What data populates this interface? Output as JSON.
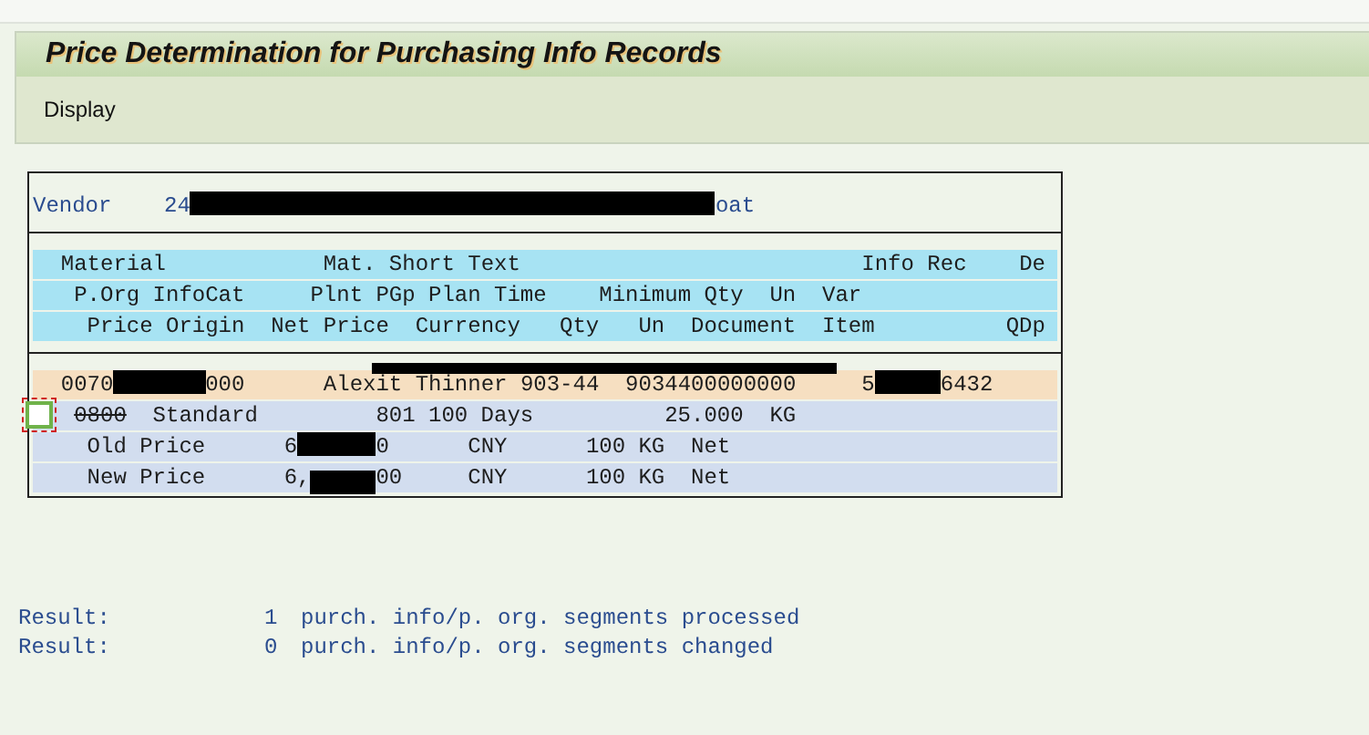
{
  "title": "Price Determination for Purchasing Info Records",
  "toolbar": [
    {
      "label": "Display"
    }
  ],
  "vendor": {
    "label": "Vendor",
    "value_start": "24",
    "value_end": "oat"
  },
  "header_rows": [
    [
      "Material",
      "Mat. Short Text",
      "Info Rec",
      "De"
    ],
    [
      "P.Org",
      "InfoCat",
      "Plnt",
      "PGp",
      "Plan Time",
      "Minimum Qty",
      "Un",
      "Var"
    ],
    [
      "Price Origin",
      "Net Price",
      "Currency",
      "Qty",
      "Un",
      "Document",
      "Item",
      "QDp"
    ]
  ],
  "item_row": {
    "cells": [
      "0070",
      "000",
      "Alexit Thinner 903-44",
      "9034400000000",
      "5",
      "6432"
    ]
  },
  "org_row": {
    "checked": false,
    "cells": [
      {
        "text": "0800",
        "struck": true
      },
      {
        "text": "Standard",
        "struck": false
      },
      {
        "text": "801",
        "struck": false
      },
      {
        "text": "100",
        "struck": false
      },
      {
        "text": "Days",
        "struck": false
      },
      {
        "text": "25.000",
        "struck": false
      },
      {
        "text": "KG",
        "struck": false
      }
    ]
  },
  "price_rows": [
    [
      "Old Price",
      "6",
      "0",
      "CNY",
      "100",
      "KG",
      "Net"
    ],
    [
      "New Price",
      "6,",
      "00",
      "CNY",
      "100",
      "KG",
      "Net"
    ]
  ],
  "results": [
    {
      "label": "Result:",
      "count": "1",
      "message": "purch. info/p. org. segments processed"
    },
    {
      "label": "Result:",
      "count": "0",
      "message": "purch. info/p. org. segments changed"
    }
  ]
}
